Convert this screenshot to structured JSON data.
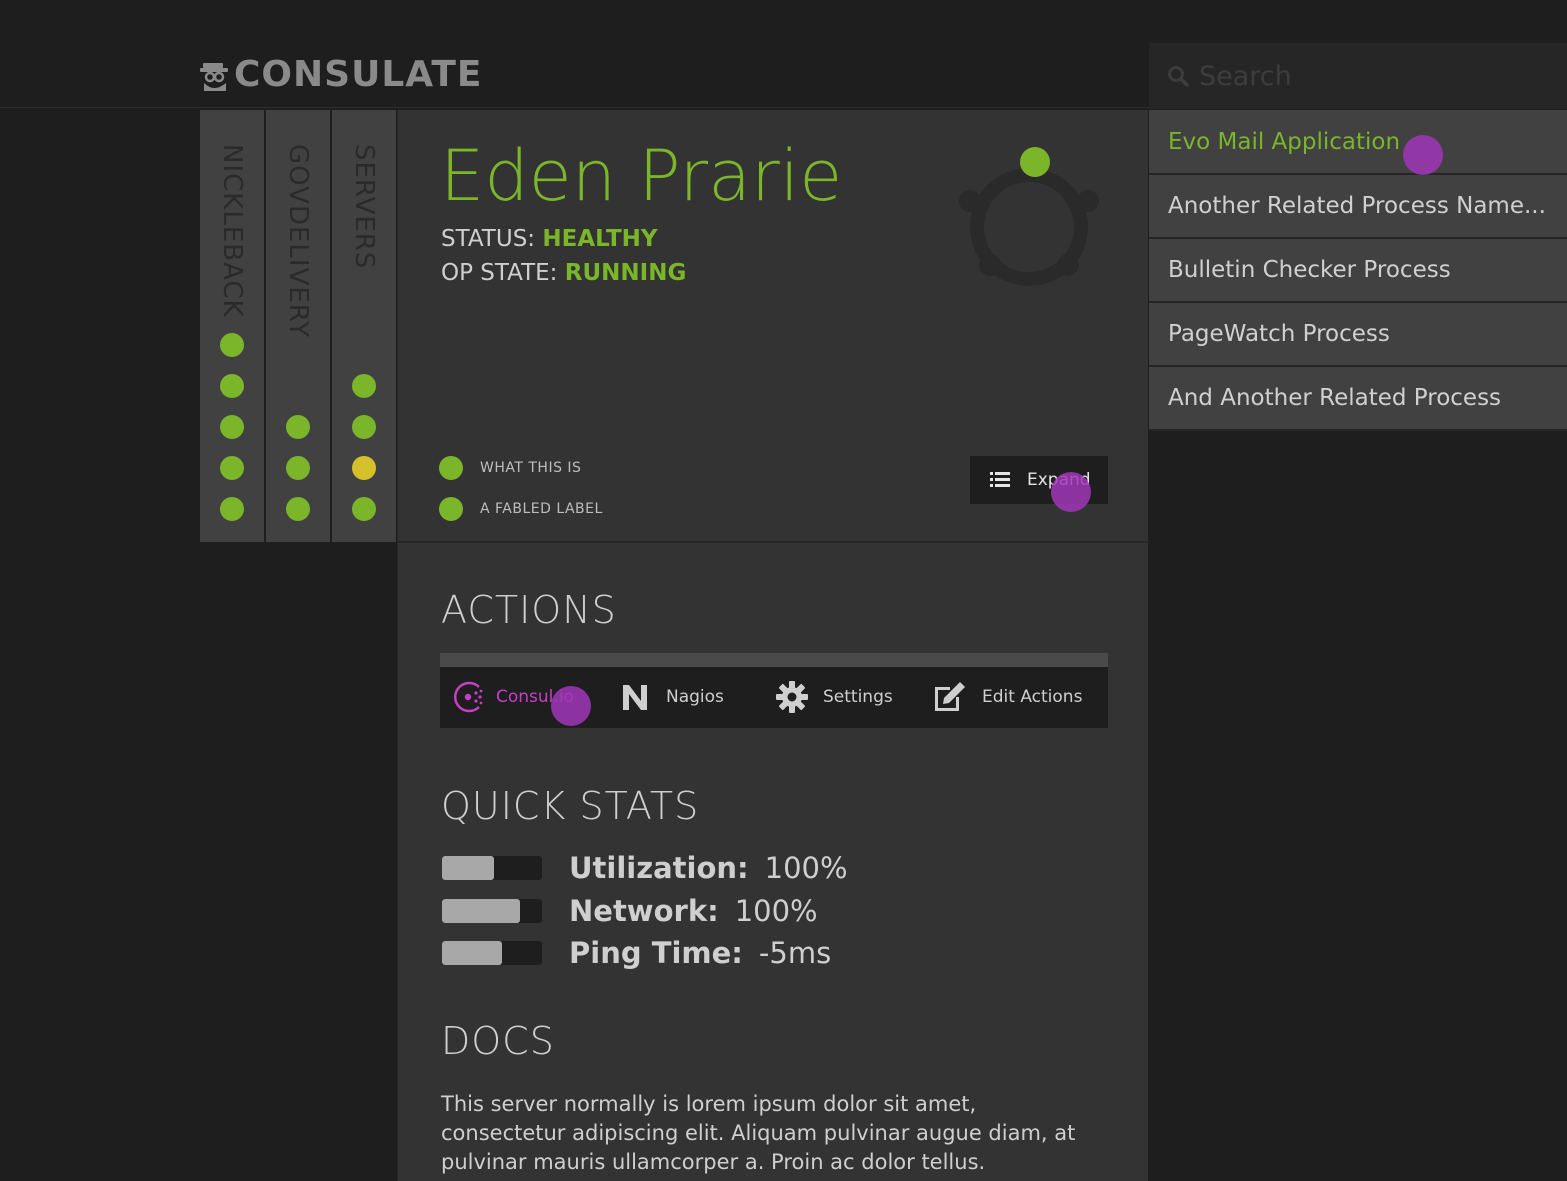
{
  "app": {
    "logo_text": "CONSULATE"
  },
  "search": {
    "placeholder": "Search"
  },
  "service_columns": [
    {
      "label": "NICKLEBACK",
      "statuses": [
        "healthy",
        "healthy",
        "healthy",
        "healthy",
        "healthy"
      ]
    },
    {
      "label": "GOVDELIVERY",
      "statuses": [
        "healthy",
        "healthy",
        "healthy"
      ]
    },
    {
      "label": "SERVERS",
      "statuses": [
        "healthy",
        "healthy",
        "warning",
        "healthy"
      ]
    }
  ],
  "server": {
    "name": "Eden Prarie",
    "status_label": "STATUS:",
    "status_value": "HEALTHY",
    "op_state_label": "OP STATE:",
    "op_state_value": "RUNNING"
  },
  "legend": [
    {
      "label": "WHAT THIS IS",
      "color": "#7ab52a"
    },
    {
      "label": "A FABLED LABEL",
      "color": "#7ab52a"
    }
  ],
  "expand_button": {
    "label": "Expand",
    "icon": "list-icon"
  },
  "actions": {
    "heading": "ACTIONS",
    "items": [
      {
        "label": "Consul.io",
        "icon": "consul-icon"
      },
      {
        "label": "Nagios",
        "icon": "nagios-icon"
      },
      {
        "label": "Settings",
        "icon": "gear-icon"
      },
      {
        "label": "Edit Actions",
        "icon": "edit-icon"
      }
    ]
  },
  "quick_stats": {
    "heading": "QUICK STATS",
    "items": [
      {
        "label": "Utilization:",
        "value": "100%",
        "level": 0.52
      },
      {
        "label": "Network:",
        "value": "100%",
        "level": 0.78
      },
      {
        "label": "Ping Time:",
        "value": "-5ms",
        "level": 0.6
      }
    ]
  },
  "docs": {
    "heading": "DOCS",
    "text": "This server normally is lorem ipsum dolor sit amet, consectetur adipiscing elit. Aliquam pulvinar augue diam, at pulvinar mauris ullamcorper a. Proin ac dolor tellus."
  },
  "processes": [
    {
      "label": "Evo Mail Application",
      "active": true
    },
    {
      "label": "Another Related Process Name...",
      "active": false
    },
    {
      "label": "Bulletin Checker Process",
      "active": false
    },
    {
      "label": "PageWatch Process",
      "active": false
    },
    {
      "label": "And Another Related Process",
      "active": false
    }
  ],
  "colors": {
    "accent_green": "#7ab52a",
    "warning_yellow": "#d6c12b",
    "consul_magenta": "#c63fc6",
    "background": "#1e1e1e",
    "panel": "#333333"
  }
}
